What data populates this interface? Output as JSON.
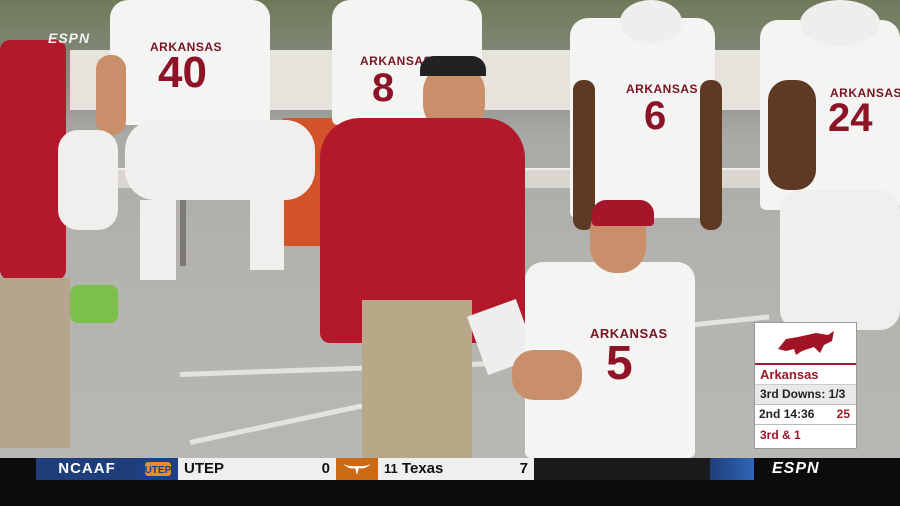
{
  "broadcast": {
    "network_corner": "ESPN",
    "network_bottom": "ESPN"
  },
  "players": {
    "bench_left_number": "40",
    "bench_mid_number": "8",
    "standing_number": "6",
    "right_number": "24",
    "qb_number": "5",
    "jersey_text": "ARKANSAS"
  },
  "scorecard": {
    "team": "Arkansas",
    "third_downs": "3rd Downs: 1/3",
    "quarter": "2nd",
    "clock": "14:36",
    "score": "25",
    "down_distance": "3rd & 1"
  },
  "ticker": {
    "league": "NCAAF",
    "team1_name": "UTEP",
    "team1_score": "0",
    "team2_rank": "11",
    "team2_name": "Texas",
    "team2_score": "7"
  },
  "colors": {
    "arkansas_red": "#a01425",
    "ticker_blue": "#1f3d7a",
    "texas_orange": "#cc6a14"
  }
}
